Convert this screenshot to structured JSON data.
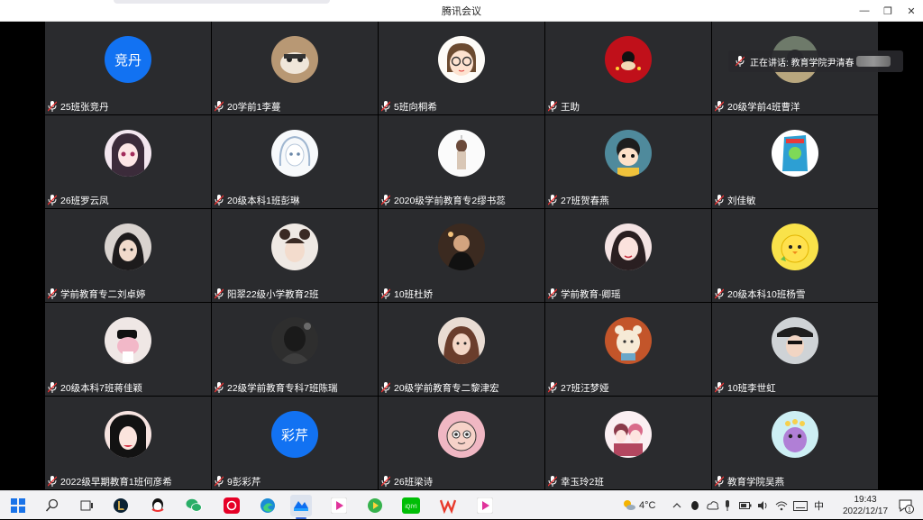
{
  "window": {
    "title": "腾讯会议",
    "controls": [
      "—",
      "❐",
      "✕"
    ]
  },
  "speaking": {
    "label": "正在讲话: 教育学院尹清春"
  },
  "participants": [
    {
      "name": "25班张竞丹",
      "avatar_text": "竞丹",
      "avatar": "text"
    },
    {
      "name": "20学前1李蔓",
      "avatar": "photo-cat"
    },
    {
      "name": "5班向桐希",
      "avatar": "cartoon-glasses"
    },
    {
      "name": "王助",
      "avatar": "red-art"
    },
    {
      "name": "20级学前4班曹洋",
      "avatar": "photo-dark"
    },
    {
      "name": "26班罗云凤",
      "avatar": "anime-purple"
    },
    {
      "name": "20级本科1班彭琳",
      "avatar": "anime-sketch"
    },
    {
      "name": "2020级学前教育专2缪书蕊",
      "avatar": "girl-white"
    },
    {
      "name": "27班贺春燕",
      "avatar": "cartoon-kid"
    },
    {
      "name": "刘佳敏",
      "avatar": "snack-bag"
    },
    {
      "name": "学前教育专二刘卓婷",
      "avatar": "photo-girl"
    },
    {
      "name": "阳翠22级小学教育2班",
      "avatar": "photo-girl-bun"
    },
    {
      "name": "10班杜娇",
      "avatar": "photo-dark-girl"
    },
    {
      "name": "学前教育-卿瑶",
      "avatar": "photo-girl-red"
    },
    {
      "name": "20级本科10班杨雪",
      "avatar": "yellow-chick"
    },
    {
      "name": "20级本科7班蒋佳颖",
      "avatar": "photo-pink"
    },
    {
      "name": "22级学前教育专科7班陈瑞",
      "avatar": "photo-shadow"
    },
    {
      "name": "20级学前教育专二黎津宏",
      "avatar": "photo-girl-brown"
    },
    {
      "name": "27班汪梦娅",
      "avatar": "cartoon-bear"
    },
    {
      "name": "10班李世虹",
      "avatar": "photo-girl-hat"
    },
    {
      "name": "2022级早期教育1班何彦希",
      "avatar": "anime-black-hair"
    },
    {
      "name": "9彭彩芹",
      "avatar_text": "彩芹",
      "avatar": "text"
    },
    {
      "name": "26班梁诗",
      "avatar": "cartoon-pink-face"
    },
    {
      "name": "幸玉玲2班",
      "avatar": "anime-couple"
    },
    {
      "name": "教育学院吴燕",
      "avatar": "purple-monster"
    }
  ],
  "taskbar": {
    "weather": "4°C",
    "ime": "中",
    "time": "19:43",
    "date": "2022/12/17",
    "notifications": "1"
  }
}
